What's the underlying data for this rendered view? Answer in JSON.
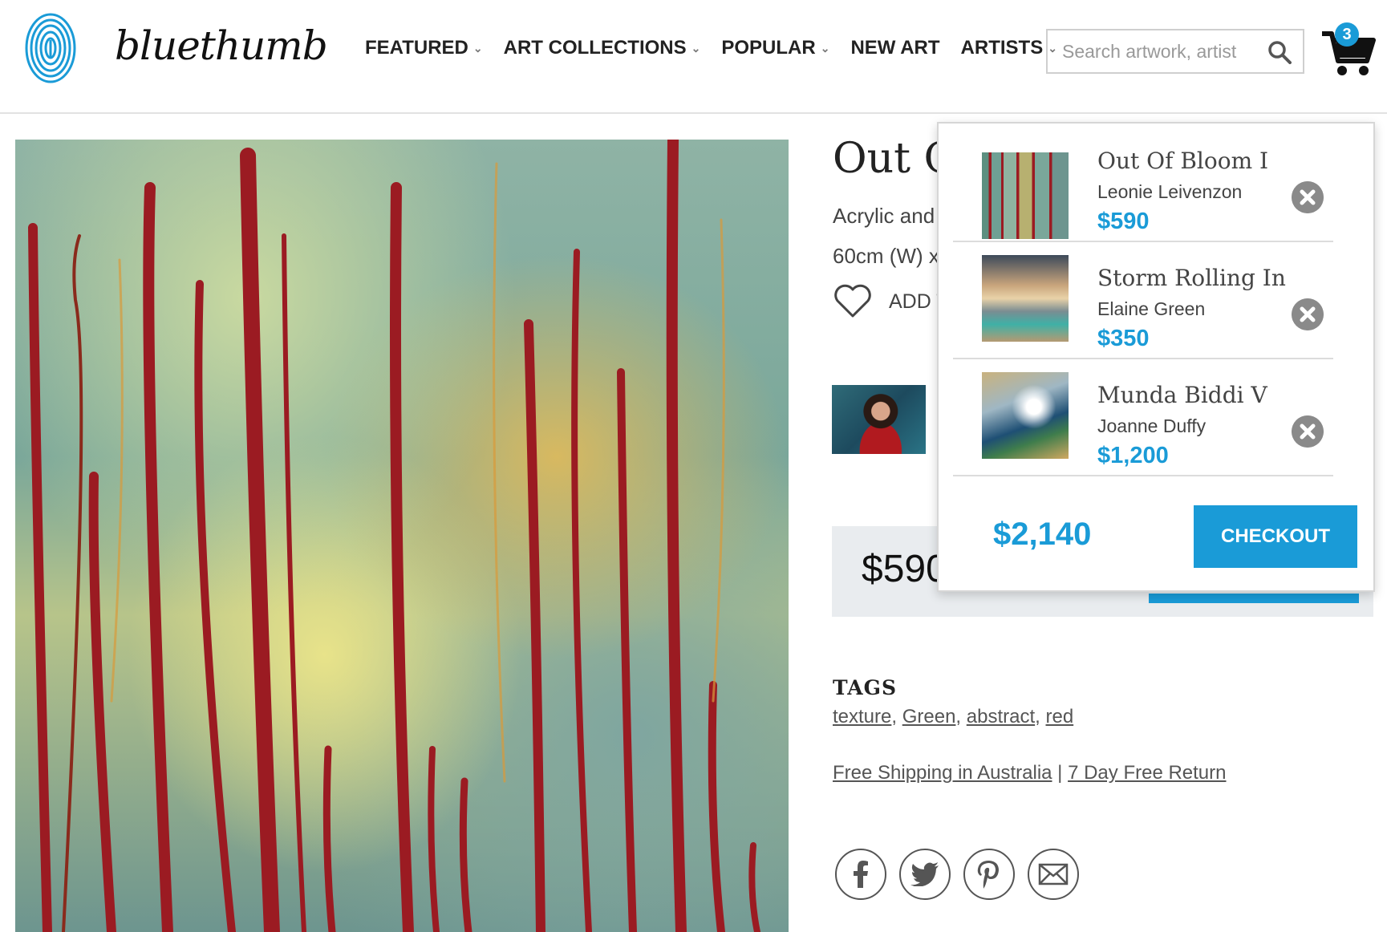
{
  "header": {
    "logo_text": "bluethumb",
    "nav": [
      {
        "label": "FEATURED",
        "has_dropdown": true
      },
      {
        "label": "ART COLLECTIONS",
        "has_dropdown": true
      },
      {
        "label": "POPULAR",
        "has_dropdown": true
      },
      {
        "label": "NEW ART",
        "has_dropdown": false
      },
      {
        "label": "ARTISTS",
        "has_dropdown": true
      }
    ],
    "search_placeholder": "Search artwork, artist",
    "cart_count": "3"
  },
  "product": {
    "title_visible": "Out C",
    "medium_visible": "Acrylic and",
    "dims_visible": "60cm (W) x",
    "favorite_label_visible": "ADD T",
    "price_visible": "$590",
    "tags_heading": "TAGS",
    "tags": [
      "texture",
      "Green",
      "abstract",
      "red"
    ],
    "shipping_link": "Free Shipping in Australia",
    "return_link": "7 Day Free Return",
    "separator": "|"
  },
  "cart_dropdown": {
    "items": [
      {
        "title": "Out Of Bloom I",
        "artist": "Leonie Leivenzon",
        "price": "$590",
        "thumb": "red-drip-green-abstract"
      },
      {
        "title": "Storm Rolling In",
        "artist": "Elaine Green",
        "price": "$350",
        "thumb": "storm-seascape"
      },
      {
        "title": "Munda Biddi V",
        "artist": "Joanne Duffy",
        "price": "$1,200",
        "thumb": "blue-abstract-landscape"
      }
    ],
    "total": "$2,140",
    "checkout_label": "CHECKOUT"
  },
  "colors": {
    "accent": "#1a9bd7",
    "price_box_bg": "#e9ecef",
    "drip_red": "#9b1b22"
  }
}
